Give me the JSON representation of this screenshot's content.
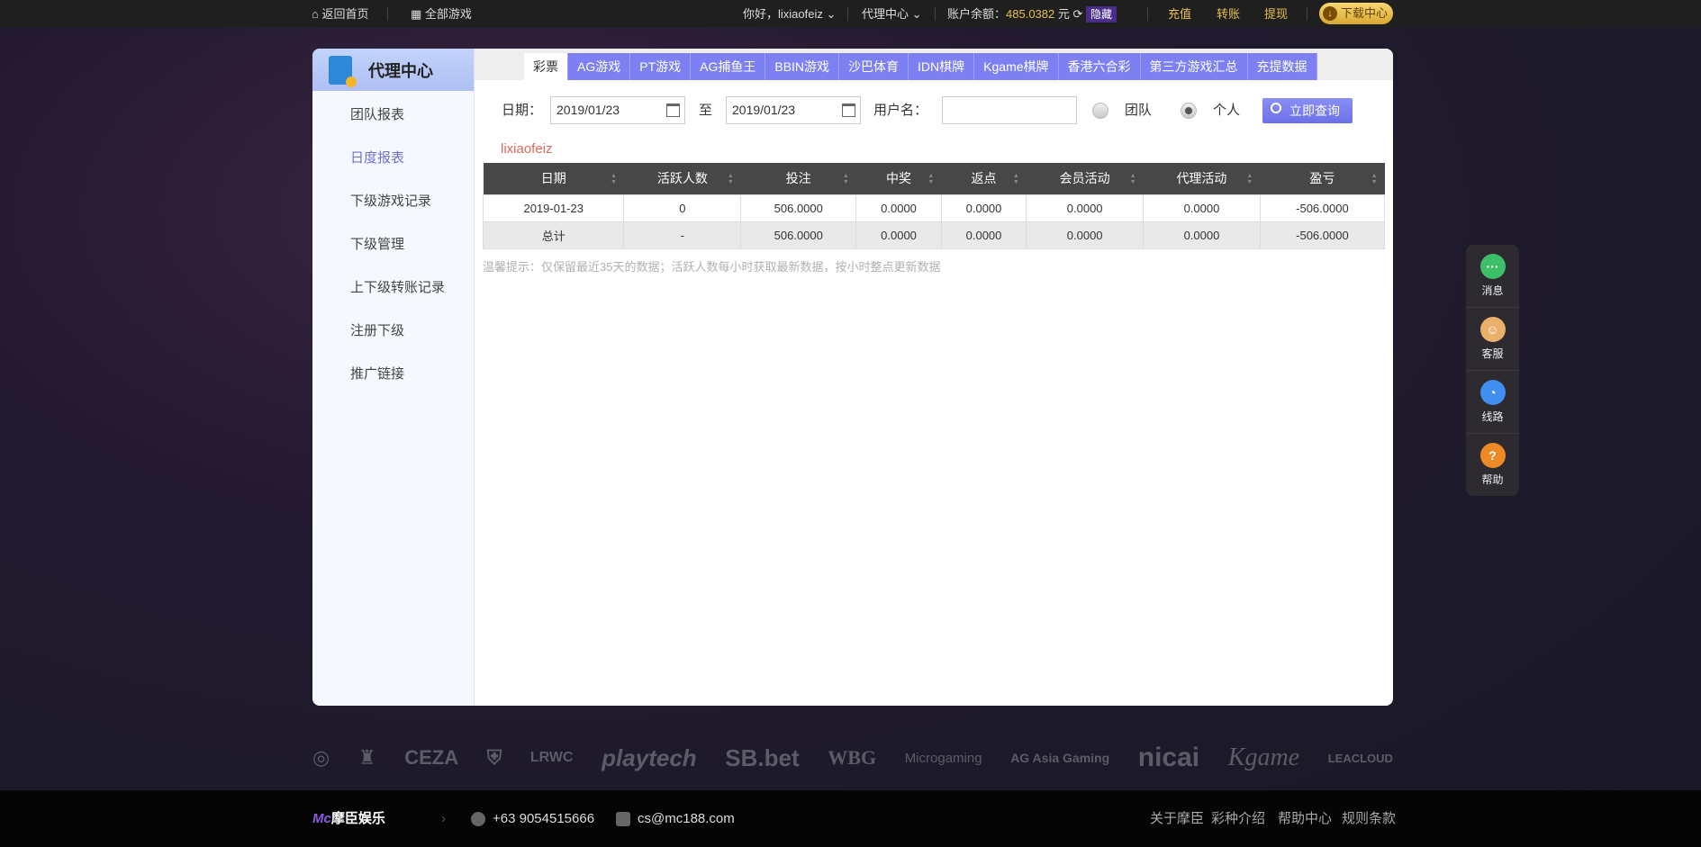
{
  "topbar": {
    "home": "返回首页",
    "all_games": "全部游戏",
    "greeting": "你好，lixiaofeiz",
    "agent_center": "代理中心",
    "balance_label": "账户余额：",
    "balance": "485.0382",
    "currency": "元",
    "hide": "隐藏",
    "deposit": "充值",
    "transfer": "转账",
    "withdraw": "提现",
    "download": "下载中心"
  },
  "sidebar": {
    "title": "代理中心",
    "items": [
      {
        "label": "团队报表"
      },
      {
        "label": "日度报表"
      },
      {
        "label": "下级游戏记录"
      },
      {
        "label": "下级管理"
      },
      {
        "label": "上下级转账记录"
      },
      {
        "label": "注册下级"
      },
      {
        "label": "推广链接"
      }
    ]
  },
  "tabs": [
    {
      "label": "彩票"
    },
    {
      "label": "AG游戏"
    },
    {
      "label": "PT游戏"
    },
    {
      "label": "AG捕鱼王"
    },
    {
      "label": "BBIN游戏"
    },
    {
      "label": "沙巴体育"
    },
    {
      "label": "IDN棋牌"
    },
    {
      "label": "Kgame棋牌"
    },
    {
      "label": "香港六合彩"
    },
    {
      "label": "第三方游戏汇总"
    },
    {
      "label": "充提数据"
    }
  ],
  "form": {
    "date_label": "日期：",
    "date_from": "2019/01/23",
    "to": "至",
    "date_to": "2019/01/23",
    "username_label": "用户名：",
    "username": "",
    "team": "团队",
    "personal": "个人",
    "query": "立即查询"
  },
  "current_user": "lixiaofeiz",
  "table": {
    "headers": [
      "日期",
      "活跃人数",
      "投注",
      "中奖",
      "返点",
      "会员活动",
      "代理活动",
      "盈亏"
    ],
    "rows": [
      [
        "2019-01-23",
        "0",
        "506.0000",
        "0.0000",
        "0.0000",
        "0.0000",
        "0.0000",
        "-506.0000"
      ]
    ],
    "total": [
      "总计",
      "-",
      "506.0000",
      "0.0000",
      "0.0000",
      "0.0000",
      "0.0000",
      "-506.0000"
    ]
  },
  "hint": "温馨提示：仅保留最近35天的数据；活跃人数每小时获取最新数据，按小时整点更新数据",
  "float": {
    "message": "消息",
    "service": "客服",
    "route": "线路",
    "help": "帮助"
  },
  "partners": [
    "CEZA",
    "LRWC",
    "playtech",
    "SB.bet",
    "WBG",
    "Microgaming",
    "AG Asia Gaming",
    "nicai",
    "Kgame",
    "LEACLOUD"
  ],
  "footer": {
    "brand": "摩臣娱乐",
    "brand_mark": "Mc",
    "phone": "+63 9054515666",
    "email": "cs@mc188.com",
    "links": [
      "关于摩臣",
      "彩种介绍",
      "帮助中心",
      "规则条款"
    ]
  }
}
